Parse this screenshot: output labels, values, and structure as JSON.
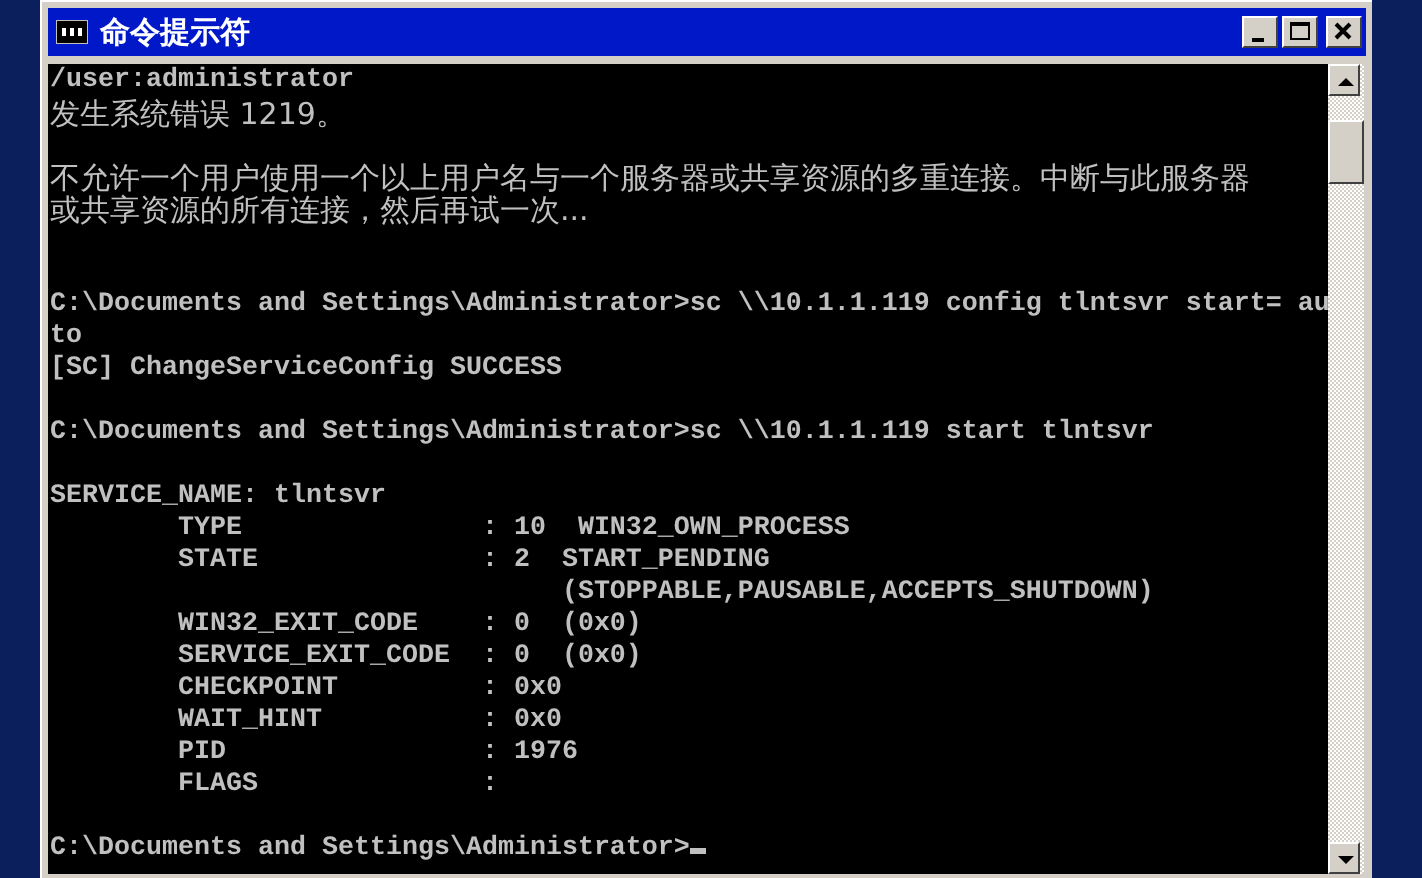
{
  "window": {
    "title": "命令提示符"
  },
  "console": {
    "lines": [
      {
        "kind": "text",
        "text": "/user:administrator"
      },
      {
        "kind": "text",
        "text": "发生系统错误 1219。"
      },
      {
        "kind": "blank"
      },
      {
        "kind": "text",
        "text": "不允许一个用户使用一个以上用户名与一个服务器或共享资源的多重连接。中断与此服务器"
      },
      {
        "kind": "text",
        "text": "或共享资源的所有连接，然后再试一次..."
      },
      {
        "kind": "blank"
      },
      {
        "kind": "blank"
      },
      {
        "kind": "text",
        "text": "C:\\Documents and Settings\\Administrator>sc \\\\10.1.1.119 config tlntsvr start= au"
      },
      {
        "kind": "text",
        "text": "to"
      },
      {
        "kind": "text",
        "text": "[SC] ChangeServiceConfig SUCCESS"
      },
      {
        "kind": "blank"
      },
      {
        "kind": "text",
        "text": "C:\\Documents and Settings\\Administrator>sc \\\\10.1.1.119 start tlntsvr"
      },
      {
        "kind": "blank"
      },
      {
        "kind": "text",
        "text": "SERVICE_NAME: tlntsvr"
      },
      {
        "kind": "text",
        "text": "        TYPE               : 10  WIN32_OWN_PROCESS"
      },
      {
        "kind": "text",
        "text": "        STATE              : 2  START_PENDING"
      },
      {
        "kind": "text",
        "text": "                                (STOPPABLE,PAUSABLE,ACCEPTS_SHUTDOWN)"
      },
      {
        "kind": "text",
        "text": "        WIN32_EXIT_CODE    : 0  (0x0)"
      },
      {
        "kind": "text",
        "text": "        SERVICE_EXIT_CODE  : 0  (0x0)"
      },
      {
        "kind": "text",
        "text": "        CHECKPOINT         : 0x0"
      },
      {
        "kind": "text",
        "text": "        WAIT_HINT          : 0x0"
      },
      {
        "kind": "text",
        "text": "        PID                : 1976"
      },
      {
        "kind": "text",
        "text": "        FLAGS              :"
      },
      {
        "kind": "blank"
      },
      {
        "kind": "prompt",
        "text": "C:\\Documents and Settings\\Administrator>"
      }
    ]
  }
}
